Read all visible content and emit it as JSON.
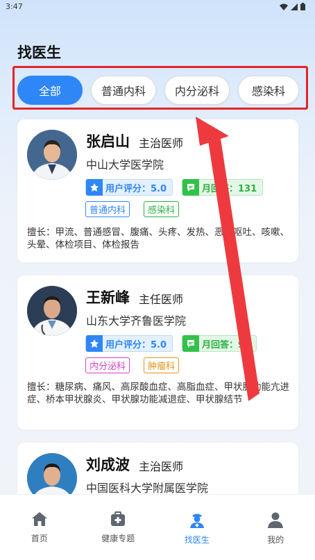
{
  "status": {
    "time": "3:47"
  },
  "page": {
    "title": "找医生"
  },
  "filters": [
    {
      "label": "全部",
      "active": true
    },
    {
      "label": "普通内科",
      "active": false
    },
    {
      "label": "内分泌科",
      "active": false
    },
    {
      "label": "感染科",
      "active": false
    }
  ],
  "doctors": [
    {
      "name": "张启山",
      "title": "主治医师",
      "hospital": "中山大学医学院",
      "score_label": "用户评分：5.0",
      "reply_label": "月回答：131",
      "tags": [
        "普通内科",
        "感染科"
      ],
      "specialty": "擅长：甲流、普通感冒、腹痛、头疼、发热、恶心呕吐、咳嗽、头晕、体检项目、体检报告"
    },
    {
      "name": "王新峰",
      "title": "主任医师",
      "hospital": "山东大学齐鲁医学院",
      "score_label": "用户评分：5.0",
      "reply_label": "月回答：97",
      "tags": [
        "内分泌科",
        "肿瘤科"
      ],
      "specialty": "擅长：糖尿病、痛风、高尿酸血症、高脂血症、甲状腺功能亢进症、桥本甲状腺炎、甲状腺功能减退症、甲状腺结节"
    },
    {
      "name": "刘成波",
      "title": "主治医师",
      "hospital": "中国医科大学附属医学院"
    }
  ],
  "tabbar": [
    {
      "label": "首页",
      "icon": "home-icon",
      "active": false
    },
    {
      "label": "健康专题",
      "icon": "medkit-icon",
      "active": false
    },
    {
      "label": "找医生",
      "icon": "doctor-icon",
      "active": true
    },
    {
      "label": "我的",
      "icon": "user-icon",
      "active": false
    }
  ],
  "colors": {
    "accent": "#2f86f6",
    "highlight": "#e5232c",
    "reply": "#2bb143"
  }
}
